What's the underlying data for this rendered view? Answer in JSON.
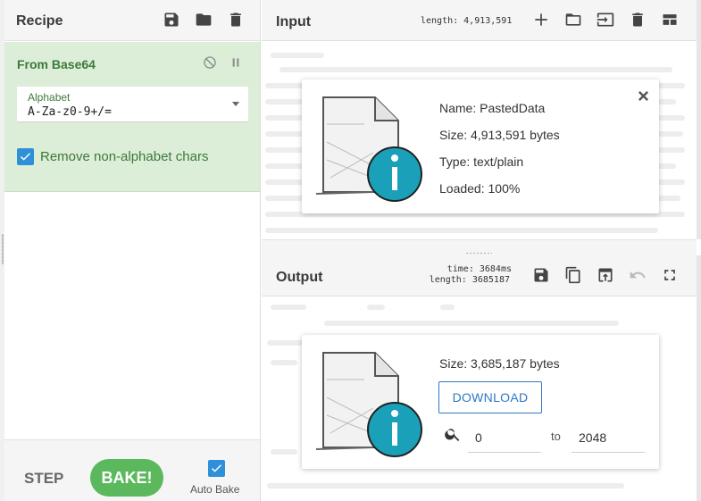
{
  "recipe": {
    "title": "Recipe",
    "icons": [
      "save-icon",
      "folder-icon",
      "trash-icon"
    ],
    "operation": {
      "title": "From Base64",
      "alphabet_label": "Alphabet",
      "alphabet_value": "A-Za-z0-9+/=",
      "remove_non_alphabet_label": "Remove non-alphabet chars",
      "remove_non_alphabet_checked": true
    },
    "step_label": "STEP",
    "bake_label": "BAKE!",
    "auto_bake_label": "Auto Bake",
    "auto_bake_checked": true
  },
  "input": {
    "title": "Input",
    "length_text": "length: 4,913,591",
    "icons": [
      "add-icon",
      "open-folder-icon",
      "input-file-icon",
      "trash-icon",
      "layout-icon"
    ],
    "file_card": {
      "name_line": "Name: PastedData",
      "size_line": "Size: 4,913,591 bytes",
      "type_line": "Type: text/plain",
      "loaded_line": "Loaded: 100%"
    }
  },
  "output": {
    "title": "Output",
    "time_text": "time:  3684ms",
    "length_text": "length: 3685187",
    "icons": [
      "save-icon",
      "copy-icon",
      "replace-input-icon",
      "undo-icon",
      "fullscreen-icon"
    ],
    "file_card": {
      "size_line": "Size: 3,685,187 bytes",
      "download_label": "DOWNLOAD",
      "range_start": "0",
      "range_to_label": "to",
      "range_end": "2048"
    }
  },
  "colors": {
    "operation_bg": "#dcedd8",
    "operation_text": "#3c7a3a",
    "bake_button": "#5cb85c",
    "checkbox": "#2f8fd8",
    "download_border": "#2f78c4",
    "file_icon_circle": "#1aa0b8"
  }
}
